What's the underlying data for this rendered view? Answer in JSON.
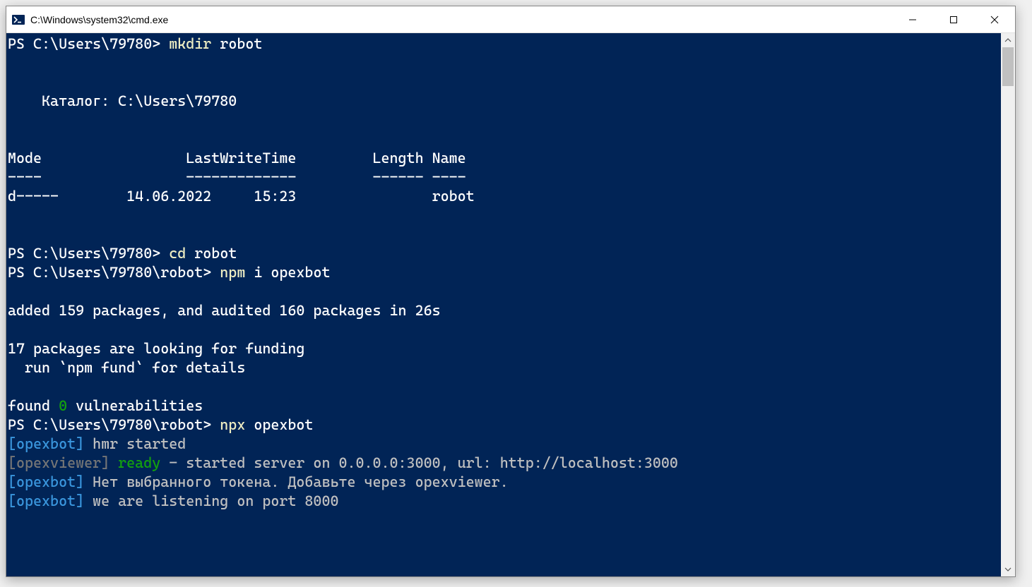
{
  "title": "C:\\Windows\\system32\\cmd.exe",
  "prompts": {
    "p1": "PS C:\\Users\\79780> ",
    "p2": "PS C:\\Users\\79780\\robot> "
  },
  "cmds": {
    "mkdir": "mkdir",
    "cd": "cd",
    "npm": "npm",
    "npx": "npx"
  },
  "args": {
    "robot": " robot",
    "i_opexbot": " i opexbot",
    "opexbot": " opexbot"
  },
  "dir": {
    "label": "    Каталог: C:\\Users\\79780",
    "header": "Mode                 LastWriteTime         Length Name",
    "divider": "----                 -------------         ------ ----",
    "row": "d-----        14.06.2022     15:23                robot"
  },
  "npm_out": {
    "added": "added 159 packages, and audited 160 packages in 26s",
    "funding1": "17 packages are looking for funding",
    "funding2": "  run `npm fund` for details",
    "found_pre": "found ",
    "found_zero": "0",
    "found_post": " vulnerabilities"
  },
  "bot": {
    "hmr_tag": "[opexbot]",
    "hmr_msg": " hmr started",
    "viewer_tag": "[opexviewer]",
    "ready": " ready",
    "ready_post": " - started server on 0.0.0.0:3000, url: http://localhost:3000",
    "token_tag": "[opexbot]",
    "token_msg": " Нет выбранного токена. Добавьте через opexviewer.",
    "listen_tag": "[opexbot]",
    "listen_msg": " we are listening on port 8000"
  }
}
